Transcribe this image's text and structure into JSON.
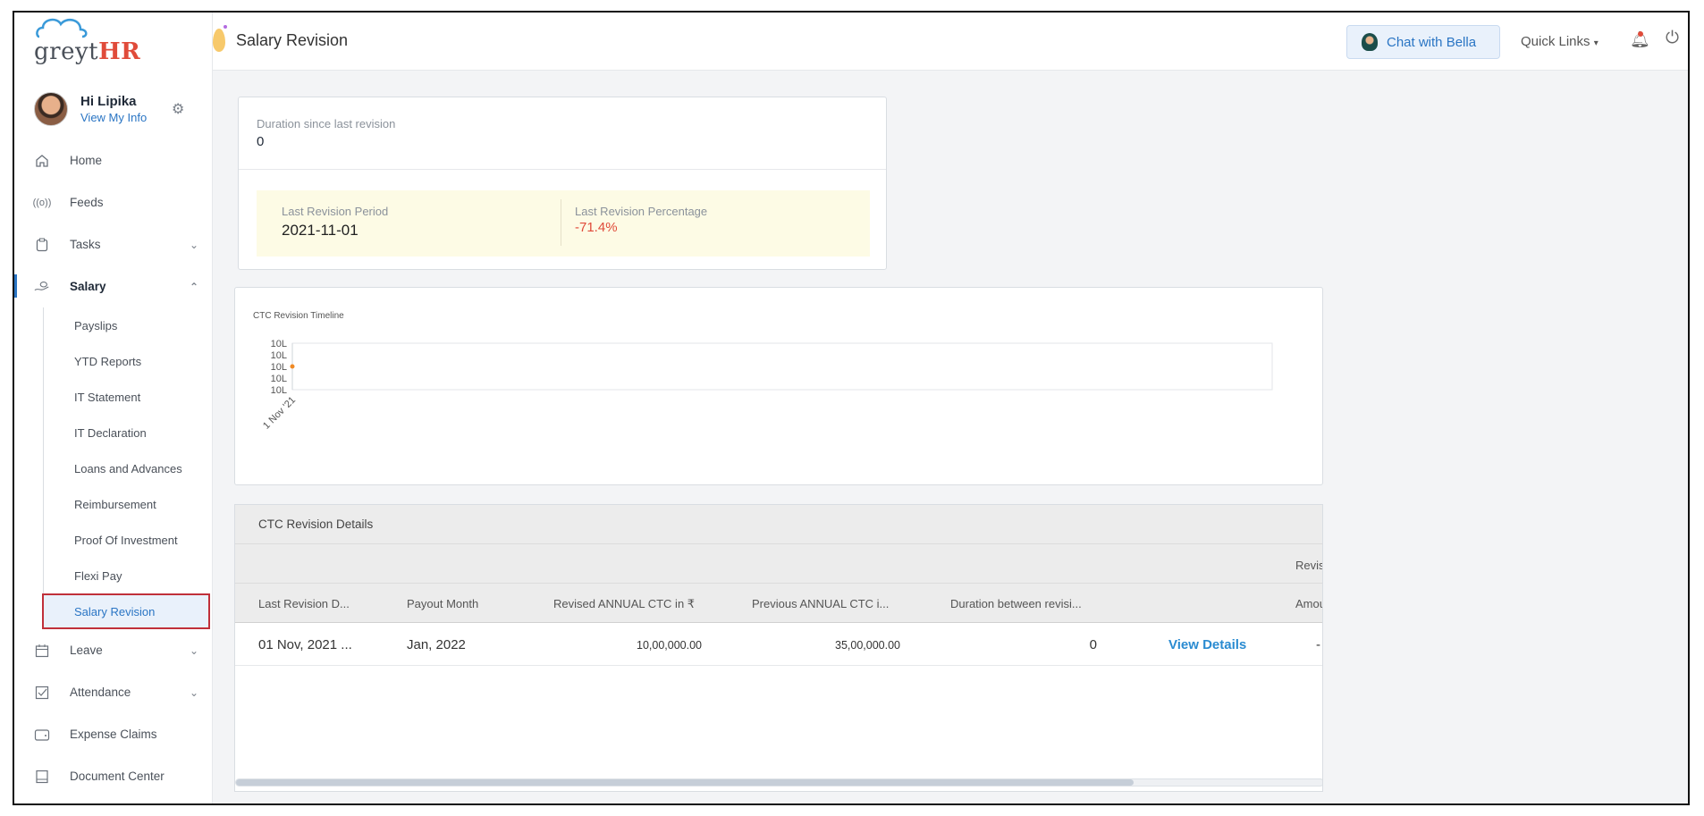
{
  "brand": {
    "logo_prefix": "greyt",
    "logo_suffix": "HR"
  },
  "user": {
    "greeting": "Hi Lipika",
    "view_info": "View My Info"
  },
  "sidebar": {
    "items": [
      {
        "label": "Home",
        "icon": "home-icon"
      },
      {
        "label": "Feeds",
        "icon": "broadcast-icon"
      },
      {
        "label": "Tasks",
        "icon": "clipboard-icon"
      },
      {
        "label": "Salary",
        "icon": "hand-money-icon"
      },
      {
        "label": "Leave",
        "icon": "calendar-icon"
      },
      {
        "label": "Attendance",
        "icon": "checkbox-icon"
      },
      {
        "label": "Expense Claims",
        "icon": "wallet-icon"
      },
      {
        "label": "Document Center",
        "icon": "document-icon"
      }
    ],
    "salary_sub": [
      "Payslips",
      "YTD Reports",
      "IT Statement",
      "IT Declaration",
      "Loans and Advances",
      "Reimbursement",
      "Proof Of Investment",
      "Flexi Pay",
      "Salary Revision"
    ]
  },
  "header": {
    "title": "Salary Revision",
    "chat": "Chat with Bella",
    "quick_links": "Quick Links"
  },
  "summary": {
    "duration_label": "Duration since last revision",
    "duration_value": "0",
    "period_label": "Last Revision Period",
    "period_value": "2021-11-01",
    "percentage_label": "Last Revision Percentage",
    "percentage_value": "-71.4%"
  },
  "chart_data": {
    "type": "line",
    "title": "CTC Revision Timeline",
    "x": [
      "1 Nov '21"
    ],
    "y_tick_labels": [
      "10L",
      "10L",
      "10L",
      "10L",
      "10L"
    ],
    "series": [
      {
        "values": [
          1000000
        ]
      }
    ],
    "point_color": "#f08a24"
  },
  "table": {
    "title": "CTC Revision Details",
    "group_header": "Revis",
    "columns": [
      "Last Revision D...",
      "Payout Month",
      "Revised ANNUAL CTC in ₹",
      "Previous ANNUAL CTC i...",
      "Duration between revisi...",
      "Amou"
    ],
    "rows": [
      {
        "last_revision": "01 Nov, 2021 ...",
        "payout_month": "Jan, 2022",
        "revised_ctc": "10,00,000.00",
        "previous_ctc": "35,00,000.00",
        "duration": "0",
        "action": "View Details",
        "amount": "-"
      }
    ]
  },
  "colors": {
    "accent": "#2a75c4",
    "negative": "#e04b3a",
    "link": "#2a8bd1"
  }
}
